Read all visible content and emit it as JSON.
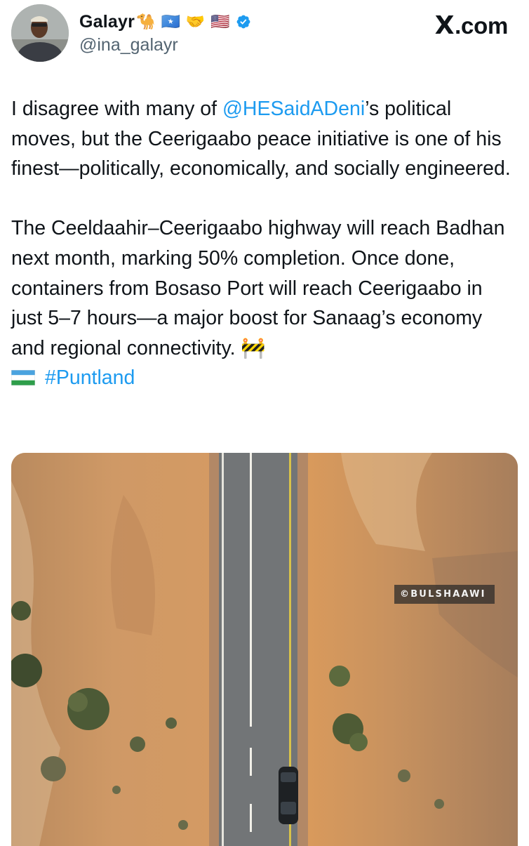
{
  "author": {
    "display_name": "Galayr",
    "handle": "@ina_galayr",
    "name_emojis": [
      "🐪",
      "🇸🇴",
      "🤝",
      "🇺🇸"
    ]
  },
  "site": {
    "label": ".com",
    "mark": "X"
  },
  "tweet": {
    "p1_before": "I disagree with many of ",
    "mention": "@HESaidADeni",
    "p1_after": "’s political moves, but the Ceerigaabo peace initiative is one of his finest—politically, economically, and socially engineered.",
    "p2": "The Ceeldaahir–Ceerigaabo highway will reach Badhan next month, marking 50% completion. Once done, containers from Bosaso Port will reach Ceerigaabo in just 5–7 hours—a major boost for Sanaag’s economy and regional connectivity. ",
    "construction_emoji": "🚧",
    "flag_emoji": "",
    "hashtag": "#Puntland"
  },
  "media": {
    "watermark": "BULSHAAWI",
    "watermark_mark": "©"
  },
  "colors": {
    "link": "#1d9bf0",
    "verified": "#1d9bf0",
    "handle": "#536471",
    "road": "#6e7173",
    "desert": "#c9925e"
  }
}
